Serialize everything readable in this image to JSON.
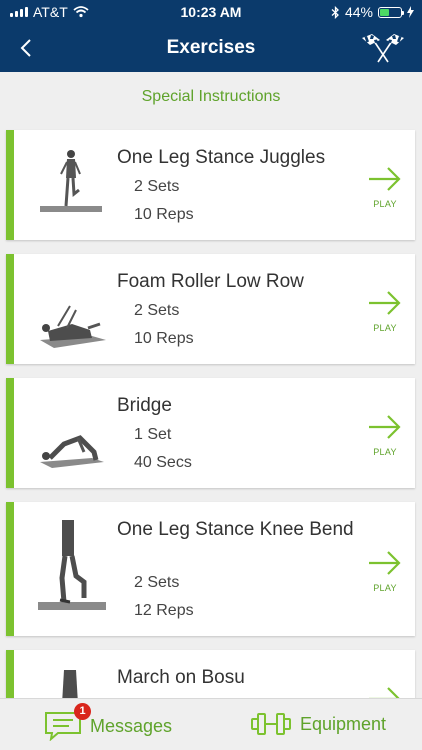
{
  "status": {
    "carrier": "AT&T",
    "time": "10:23 AM",
    "battery": "44%",
    "battery_level": 0.44
  },
  "nav": {
    "title": "Exercises"
  },
  "special_instructions": "Special Instructions",
  "exercises": [
    {
      "name": "One Leg Stance Juggles",
      "line1": "2 Sets",
      "line2": "10 Reps",
      "play": "PLAY"
    },
    {
      "name": "Foam Roller Low Row",
      "line1": "2 Sets",
      "line2": "10 Reps",
      "play": "PLAY"
    },
    {
      "name": "Bridge",
      "line1": "1 Set",
      "line2": "40 Secs",
      "play": "PLAY"
    },
    {
      "name": "One Leg Stance Knee Bend",
      "line1": "2 Sets",
      "line2": "12 Reps",
      "play": "PLAY"
    },
    {
      "name": "March on Bosu"
    }
  ],
  "tabs": {
    "messages": "Messages",
    "messages_badge": "1",
    "equipment": "Equipment"
  },
  "colors": {
    "nav_bg": "#0b3a6b",
    "accent_green": "#7cc22f",
    "text_green": "#5fa32b",
    "badge_red": "#d9261c"
  }
}
